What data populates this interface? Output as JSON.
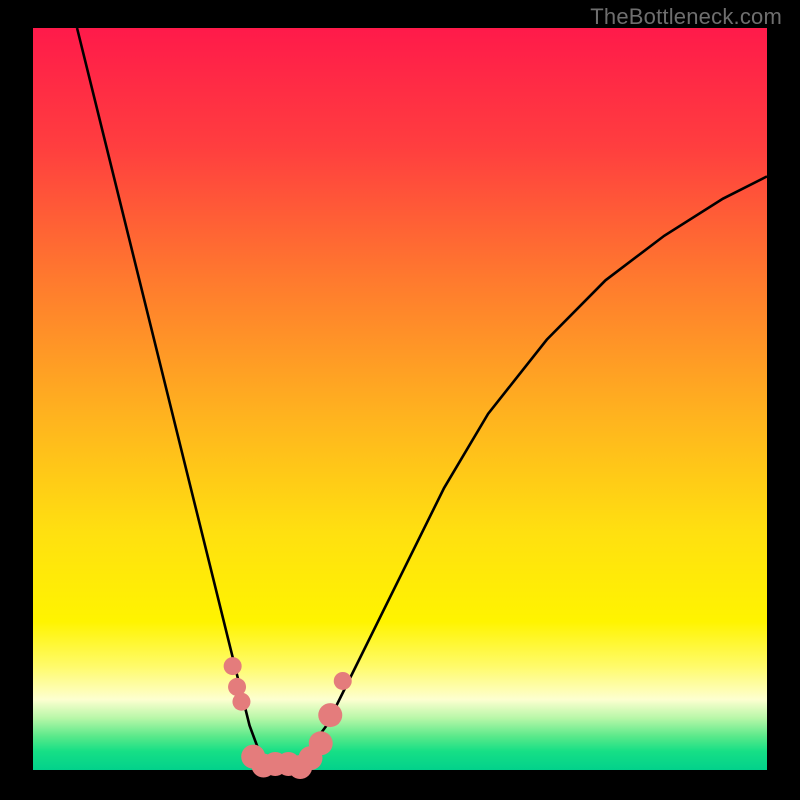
{
  "watermark": "TheBottleneck.com",
  "chart_data": {
    "type": "line",
    "title": "",
    "xlabel": "",
    "ylabel": "",
    "xlim": [
      0,
      100
    ],
    "ylim": [
      0,
      1
    ],
    "axes_visible": false,
    "background": {
      "type": "vertical-gradient",
      "stops": [
        {
          "pos": 0.0,
          "color": "#ff1a4a"
        },
        {
          "pos": 0.16,
          "color": "#ff3e3f"
        },
        {
          "pos": 0.34,
          "color": "#ff7a2e"
        },
        {
          "pos": 0.52,
          "color": "#ffb21f"
        },
        {
          "pos": 0.68,
          "color": "#ffe010"
        },
        {
          "pos": 0.8,
          "color": "#fff400"
        },
        {
          "pos": 0.86,
          "color": "#fffb6a"
        },
        {
          "pos": 0.905,
          "color": "#fdffd0"
        },
        {
          "pos": 0.93,
          "color": "#b8f7a8"
        },
        {
          "pos": 0.955,
          "color": "#59e98a"
        },
        {
          "pos": 0.975,
          "color": "#16df86"
        },
        {
          "pos": 1.0,
          "color": "#02d18b"
        }
      ]
    },
    "series": [
      {
        "name": "bottleneck-curve",
        "x": [
          6,
          8,
          10,
          12,
          14,
          16,
          18,
          20,
          22,
          24,
          26,
          28,
          29.5,
          31,
          33,
          35,
          37,
          40,
          44,
          50,
          56,
          62,
          70,
          78,
          86,
          94,
          100
        ],
        "y": [
          1.0,
          0.92,
          0.84,
          0.76,
          0.68,
          0.6,
          0.52,
          0.44,
          0.36,
          0.28,
          0.2,
          0.12,
          0.06,
          0.02,
          0.0,
          0.0,
          0.02,
          0.06,
          0.14,
          0.26,
          0.38,
          0.48,
          0.58,
          0.66,
          0.72,
          0.77,
          0.8
        ]
      }
    ],
    "markers": {
      "color": "#e47c7c",
      "radius_small": 9,
      "radius_large": 12,
      "points": [
        {
          "x": 27.2,
          "y": 0.14,
          "r": "small"
        },
        {
          "x": 27.8,
          "y": 0.112,
          "r": "small"
        },
        {
          "x": 28.4,
          "y": 0.092,
          "r": "small"
        },
        {
          "x": 30.0,
          "y": 0.018,
          "r": "large"
        },
        {
          "x": 31.4,
          "y": 0.006,
          "r": "large"
        },
        {
          "x": 33.0,
          "y": 0.0,
          "r": "large"
        },
        {
          "x": 34.8,
          "y": 0.0,
          "r": "large"
        },
        {
          "x": 36.4,
          "y": 0.004,
          "r": "large"
        },
        {
          "x": 37.8,
          "y": 0.016,
          "r": "large"
        },
        {
          "x": 39.2,
          "y": 0.036,
          "r": "large"
        },
        {
          "x": 40.5,
          "y": 0.074,
          "r": "large"
        },
        {
          "x": 42.2,
          "y": 0.12,
          "r": "small"
        }
      ]
    }
  }
}
